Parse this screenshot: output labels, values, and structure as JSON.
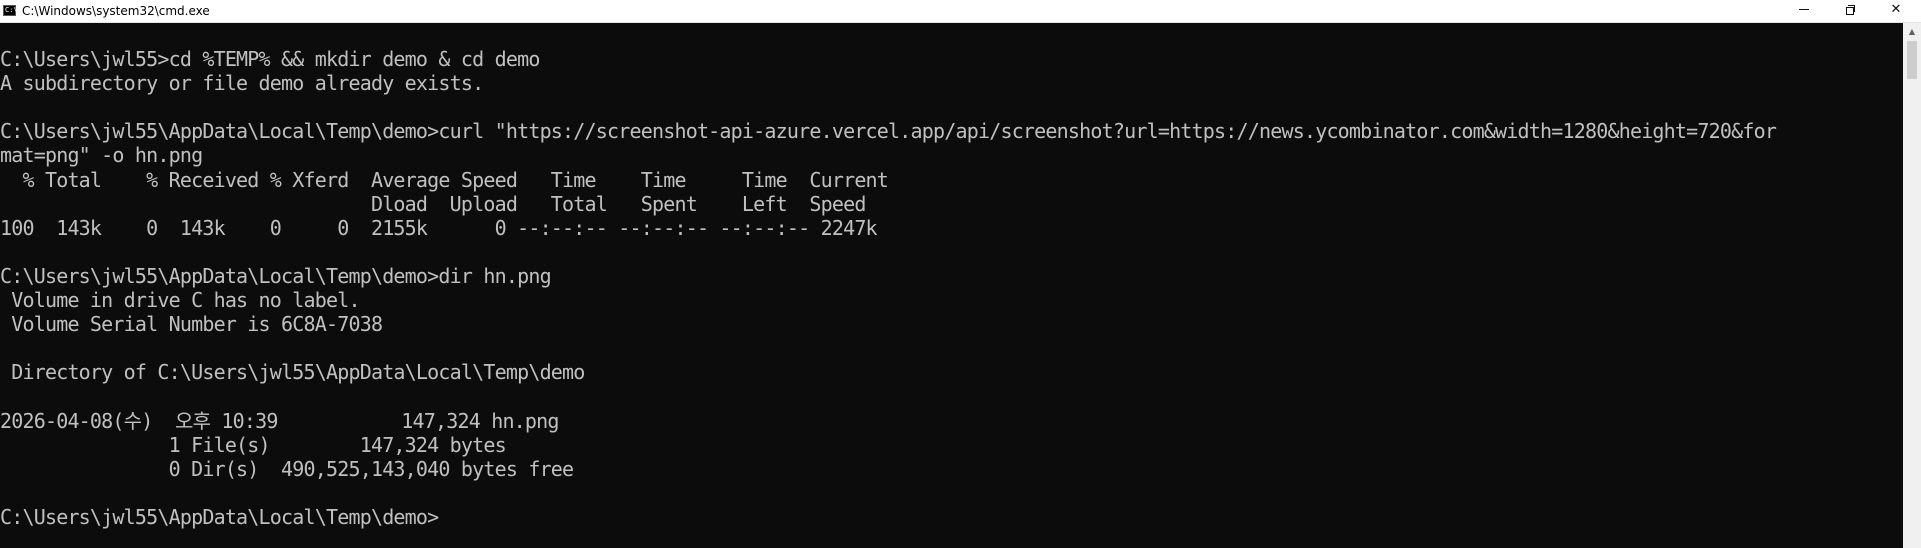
{
  "window": {
    "title": "C:\\Windows\\system32\\cmd.exe",
    "icon": "console-icon",
    "icon_text": "C:\\",
    "buttons": {
      "minimize": "minimize-icon",
      "maximize": "restore-icon",
      "close_label": "✕"
    }
  },
  "console": {
    "lines": [
      "",
      "C:\\Users\\jwl55>cd %TEMP% && mkdir demo & cd demo",
      "A subdirectory or file demo already exists.",
      "",
      "C:\\Users\\jwl55\\AppData\\Local\\Temp\\demo>curl \"https://screenshot-api-azure.vercel.app/api/screenshot?url=https://news.ycombinator.com&width=1280&height=720&for",
      "mat=png\" -o hn.png",
      "  % Total    % Received % Xferd  Average Speed   Time    Time     Time  Current",
      "                                 Dload  Upload   Total   Spent    Left  Speed",
      "100  143k    0  143k    0     0  2155k      0 --:--:-- --:--:-- --:--:-- 2247k",
      "",
      "C:\\Users\\jwl55\\AppData\\Local\\Temp\\demo>dir hn.png",
      " Volume in drive C has no label.",
      " Volume Serial Number is 6C8A-7038",
      "",
      " Directory of C:\\Users\\jwl55\\AppData\\Local\\Temp\\demo",
      "",
      "2026-04-08(수)  오후 10:39           147,324 hn.png",
      "               1 File(s)        147,324 bytes",
      "               0 Dir(s)  490,525,143,040 bytes free",
      "",
      "C:\\Users\\jwl55\\AppData\\Local\\Temp\\demo>"
    ]
  },
  "scrollbar": {
    "up_arrow": "▲"
  },
  "colors": {
    "background": "#0c0c0c",
    "foreground": "#c0c0c0",
    "titlebar": "#ffffff"
  }
}
